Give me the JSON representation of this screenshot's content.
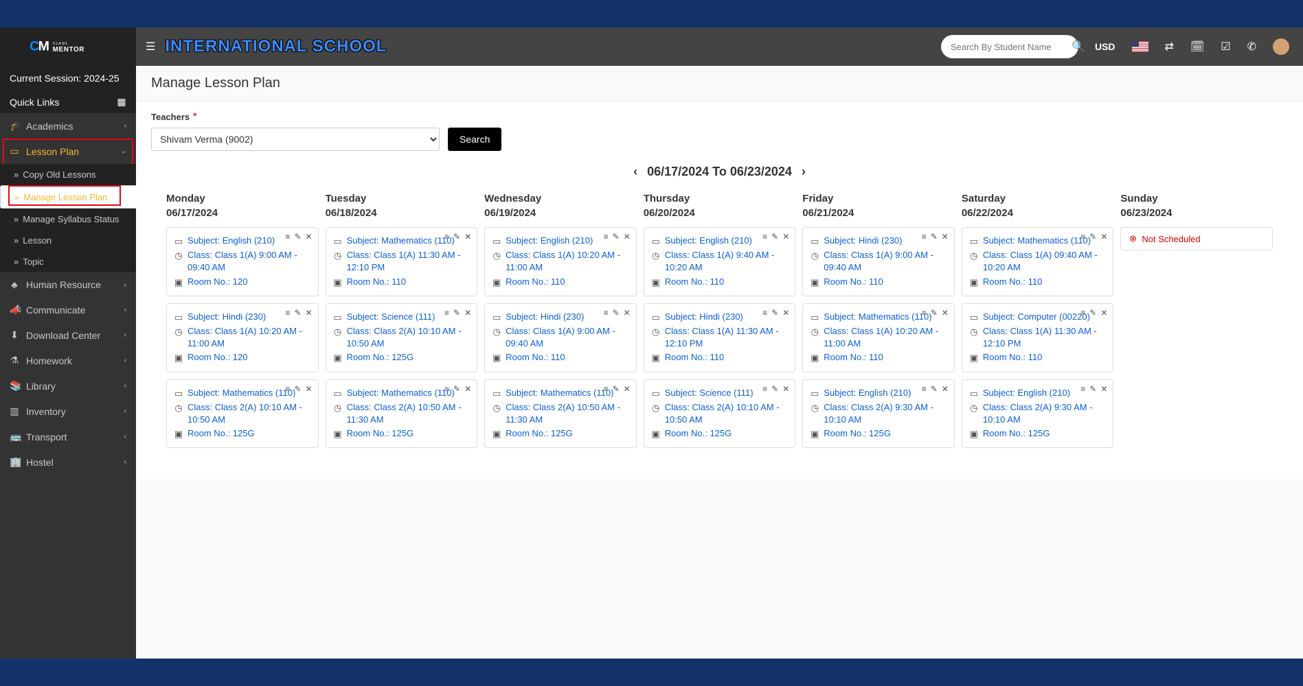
{
  "header": {
    "school": "INTERNATIONAL SCHOOL",
    "search_placeholder": "Search By Student Name",
    "currency": "USD"
  },
  "sidebar": {
    "session": "Current Session: 2024-25",
    "quick_links": "Quick Links",
    "items": [
      {
        "label": "Academics"
      },
      {
        "label": "Lesson Plan"
      },
      {
        "label": "Human Resource"
      },
      {
        "label": "Communicate"
      },
      {
        "label": "Download Center"
      },
      {
        "label": "Homework"
      },
      {
        "label": "Library"
      },
      {
        "label": "Inventory"
      },
      {
        "label": "Transport"
      },
      {
        "label": "Hostel"
      }
    ],
    "lesson_sub": [
      {
        "label": "Copy Old Lessons"
      },
      {
        "label": "Manage Lesson Plan"
      },
      {
        "label": "Manage Syllabus Status"
      },
      {
        "label": "Lesson"
      },
      {
        "label": "Topic"
      }
    ]
  },
  "page": {
    "title": "Manage Lesson Plan",
    "teacher_label": "Teachers",
    "teacher_value": "Shivam Verma (9002)",
    "search_btn": "Search",
    "week_range": "06/17/2024 To 06/23/2024",
    "not_scheduled": "Not Scheduled",
    "days": [
      {
        "name": "Monday",
        "date": "06/17/2024",
        "lessons": [
          {
            "subject": "Subject: English (210)",
            "class": "Class: Class 1(A) 9:00 AM - 09:40 AM",
            "room": "Room No.: 120"
          },
          {
            "subject": "Subject: Hindi (230)",
            "class": "Class: Class 1(A) 10:20 AM - 11:00 AM",
            "room": "Room No.: 120"
          },
          {
            "subject": "Subject: Mathematics (110)",
            "class": "Class: Class 2(A) 10:10 AM - 10:50 AM",
            "room": "Room No.: 125G"
          }
        ]
      },
      {
        "name": "Tuesday",
        "date": "06/18/2024",
        "lessons": [
          {
            "subject": "Subject: Mathematics (110)",
            "class": "Class: Class 1(A) 11:30 AM - 12:10 PM",
            "room": "Room No.: 110"
          },
          {
            "subject": "Subject: Science (111)",
            "class": "Class: Class 2(A) 10:10 AM - 10:50 AM",
            "room": "Room No.: 125G"
          },
          {
            "subject": "Subject: Mathematics (110)",
            "class": "Class: Class 2(A) 10:50 AM - 11:30 AM",
            "room": "Room No.: 125G"
          }
        ]
      },
      {
        "name": "Wednesday",
        "date": "06/19/2024",
        "lessons": [
          {
            "subject": "Subject: English (210)",
            "class": "Class: Class 1(A) 10:20 AM - 11:00 AM",
            "room": "Room No.: 110"
          },
          {
            "subject": "Subject: Hindi (230)",
            "class": "Class: Class 1(A) 9:00 AM - 09:40 AM",
            "room": "Room No.: 110"
          },
          {
            "subject": "Subject: Mathematics (110)",
            "class": "Class: Class 2(A) 10:50 AM - 11:30 AM",
            "room": "Room No.: 125G"
          }
        ]
      },
      {
        "name": "Thursday",
        "date": "06/20/2024",
        "lessons": [
          {
            "subject": "Subject: English (210)",
            "class": "Class: Class 1(A) 9:40 AM - 10:20 AM",
            "room": "Room No.: 110"
          },
          {
            "subject": "Subject: Hindi (230)",
            "class": "Class: Class 1(A) 11:30 AM - 12:10 PM",
            "room": "Room No.: 110"
          },
          {
            "subject": "Subject: Science (111)",
            "class": "Class: Class 2(A) 10:10 AM - 10:50 AM",
            "room": "Room No.: 125G"
          }
        ]
      },
      {
        "name": "Friday",
        "date": "06/21/2024",
        "lessons": [
          {
            "subject": "Subject: Hindi (230)",
            "class": "Class: Class 1(A) 9:00 AM - 09:40 AM",
            "room": "Room No.: 110"
          },
          {
            "subject": "Subject: Mathematics (110)",
            "class": "Class: Class 1(A) 10:20 AM - 11:00 AM",
            "room": "Room No.: 110"
          },
          {
            "subject": "Subject: English (210)",
            "class": "Class: Class 2(A) 9:30 AM - 10:10 AM",
            "room": "Room No.: 125G"
          }
        ]
      },
      {
        "name": "Saturday",
        "date": "06/22/2024",
        "lessons": [
          {
            "subject": "Subject: Mathematics (110)",
            "class": "Class: Class 1(A) 09:40 AM - 10:20 AM",
            "room": "Room No.: 110"
          },
          {
            "subject": "Subject: Computer (00220)",
            "class": "Class: Class 1(A) 11:30 AM - 12:10 PM",
            "room": "Room No.: 110"
          },
          {
            "subject": "Subject: English (210)",
            "class": "Class: Class 2(A) 9:30 AM - 10:10 AM",
            "room": "Room No.: 125G"
          }
        ]
      },
      {
        "name": "Sunday",
        "date": "06/23/2024",
        "lessons": []
      }
    ]
  }
}
